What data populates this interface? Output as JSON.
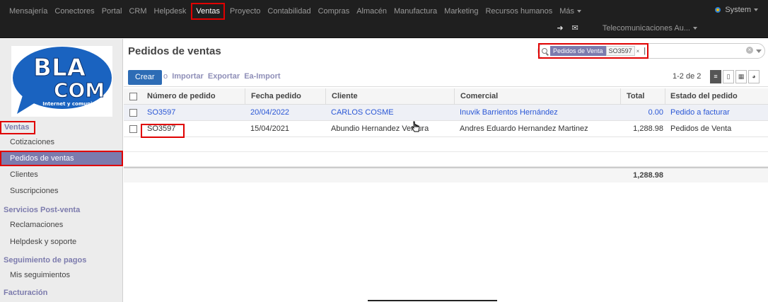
{
  "navbar": {
    "menu": [
      "Mensajería",
      "Conectores",
      "Portal",
      "CRM",
      "Helpdesk",
      "Ventas",
      "Proyecto",
      "Contabilidad",
      "Compras",
      "Almacén",
      "Manufactura",
      "Marketing",
      "Recursos humanos",
      "Más"
    ],
    "active": "Ventas",
    "user": "System",
    "company": "Telecomunicaciones Au..."
  },
  "logo": {
    "line1": "BLA",
    "line2": "COM",
    "tagline": "Internet y comunicación"
  },
  "sidebar": {
    "sections": [
      {
        "title": "Ventas",
        "items": [
          "Cotizaciones",
          "Pedidos de ventas",
          "Clientes",
          "Suscripciones"
        ]
      },
      {
        "title": "Servicios Post-venta",
        "items": [
          "Reclamaciones",
          "Helpdesk y soporte"
        ]
      },
      {
        "title": "Seguimiento de pagos",
        "items": [
          "Mis seguimientos"
        ]
      },
      {
        "title": "Facturación",
        "items": []
      }
    ],
    "active_item": "Pedidos de ventas"
  },
  "main": {
    "title": "Pedidos de ventas",
    "search": {
      "facet_category": "Pedidos de Venta",
      "facet_value": "SO3597",
      "typed": "|"
    },
    "create_label": "Crear",
    "action_links": [
      "o",
      "Importar",
      "Exportar",
      "Ea-Import"
    ],
    "pager": "1-2 de 2",
    "columns": [
      "Número de pedido",
      "Fecha pedido",
      "Cliente",
      "Comercial",
      "Total",
      "Estado del pedido"
    ],
    "rows": [
      {
        "order": "SO3597",
        "date": "20/04/2022",
        "client": "CARLOS COSME",
        "salesperson": "Inuvik Barrientos Hernández",
        "total": "0.00",
        "state": "Pedido a facturar"
      },
      {
        "order": "SO3597",
        "date": "15/04/2021",
        "client": "Abundio Hernandez Ventura",
        "salesperson": "Andres Eduardo Hernandez Martinez",
        "total": "1,288.98",
        "state": "Pedidos de Venta"
      }
    ],
    "grand_total": "1,288.98"
  }
}
